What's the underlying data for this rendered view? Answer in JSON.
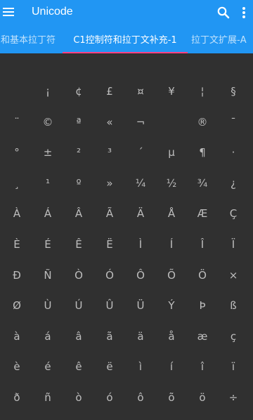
{
  "appbar": {
    "title": "Unicode",
    "color": "#2196f3",
    "menu_icon": "menu-icon",
    "search_icon": "search-icon",
    "more_icon": "more-vert-icon"
  },
  "tabs": [
    {
      "label": "和基本拉丁符",
      "active": false
    },
    {
      "label": "C1控制符和拉丁文补充-1",
      "active": true
    },
    {
      "label": "拉丁文扩展-A",
      "active": false
    }
  ],
  "tab_indicator_color": "#ff4081",
  "characters": [
    [
      " ",
      "¡",
      "¢",
      "£",
      "¤",
      "¥",
      "¦",
      "§"
    ],
    [
      "¨",
      "©",
      "ª",
      "«",
      "¬",
      "",
      "®",
      "¯"
    ],
    [
      "°",
      "±",
      "²",
      "³",
      "´",
      "µ",
      "¶",
      "·"
    ],
    [
      "¸",
      "¹",
      "º",
      "»",
      "¼",
      "½",
      "¾",
      "¿"
    ],
    [
      "À",
      "Á",
      "Â",
      "Ã",
      "Ä",
      "Å",
      "Æ",
      "Ç"
    ],
    [
      "È",
      "É",
      "Ê",
      "Ë",
      "Ì",
      "Í",
      "Î",
      "Ï"
    ],
    [
      "Ð",
      "Ñ",
      "Ò",
      "Ó",
      "Ô",
      "Õ",
      "Ö",
      "×"
    ],
    [
      "Ø",
      "Ù",
      "Ú",
      "Û",
      "Ü",
      "Ý",
      "Þ",
      "ß"
    ],
    [
      "à",
      "á",
      "â",
      "ã",
      "ä",
      "å",
      "æ",
      "ç"
    ],
    [
      "è",
      "é",
      "ê",
      "ë",
      "ì",
      "í",
      "î",
      "ï"
    ],
    [
      "ð",
      "ñ",
      "ò",
      "ó",
      "ô",
      "õ",
      "ö",
      "÷"
    ]
  ]
}
